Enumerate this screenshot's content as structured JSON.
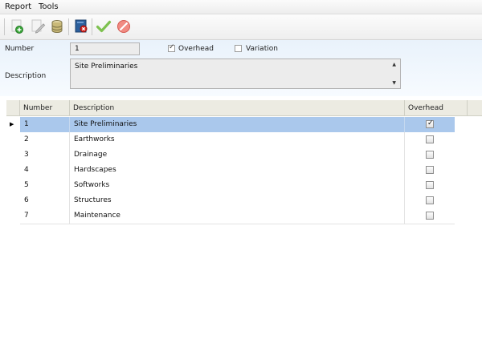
{
  "menu": {
    "items": [
      "Report",
      "Tools"
    ]
  },
  "toolbar": {
    "buttons": [
      "new-icon",
      "edit-icon",
      "database-icon",
      "delete-icon",
      "save-check-icon",
      "cancel-icon"
    ]
  },
  "form": {
    "number_label": "Number",
    "number_value": "1",
    "overhead_label": "Overhead",
    "overhead_checked": true,
    "variation_label": "Variation",
    "variation_checked": false,
    "description_label": "Description",
    "description_value": "Site Preliminaries"
  },
  "grid": {
    "columns": [
      "Number",
      "Description",
      "Overhead"
    ],
    "rows": [
      {
        "number": "1",
        "description": "Site Preliminaries",
        "overhead": true,
        "selected": true
      },
      {
        "number": "2",
        "description": "Earthworks",
        "overhead": false,
        "selected": false
      },
      {
        "number": "3",
        "description": "Drainage",
        "overhead": false,
        "selected": false
      },
      {
        "number": "4",
        "description": "Hardscapes",
        "overhead": false,
        "selected": false
      },
      {
        "number": "5",
        "description": "Softworks",
        "overhead": false,
        "selected": false
      },
      {
        "number": "6",
        "description": "Structures",
        "overhead": false,
        "selected": false
      },
      {
        "number": "7",
        "description": "Maintenance",
        "overhead": false,
        "selected": false
      }
    ]
  }
}
